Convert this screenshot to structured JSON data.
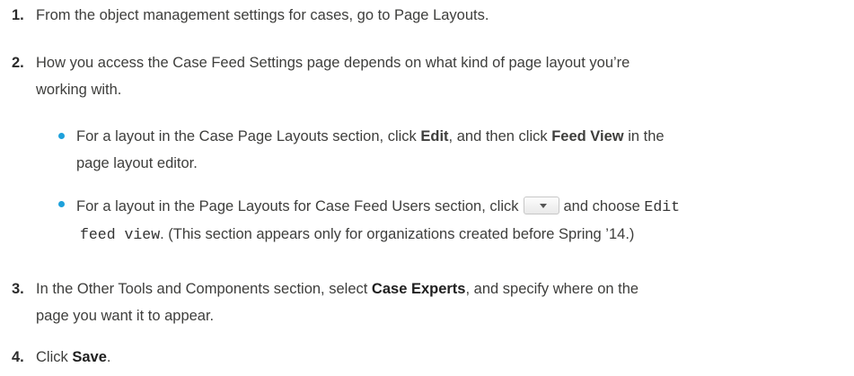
{
  "steps": [
    {
      "number": "1.",
      "text": "From the object management settings for cases, go to Page Layouts."
    },
    {
      "number": "2.",
      "text_line1": "How you access the Case Feed Settings page depends on what kind of page layout you’re",
      "text_line2": "working with.",
      "bullets": [
        {
          "pre": "For a layout in the Case Page Layouts section, click ",
          "bold1": "Edit",
          "mid": ", and then click ",
          "bold2": "Feed View",
          "post": " in the",
          "line2": "page layout editor."
        },
        {
          "pre": "For a layout in the Page Layouts for Case Feed Users section, click",
          "dropdown_icon": "dropdown-menu-button-icon",
          "mid": "and choose",
          "code1": "Edit",
          "code2": "feed view",
          "post": ". (This section appears only for organizations created before Spring ’14.)"
        }
      ]
    },
    {
      "number": "3.",
      "pre": "In the Other Tools and Components section, select ",
      "bold": "Case Experts",
      "post": ", and specify where on the",
      "line2": "page you want it to appear."
    },
    {
      "number": "4.",
      "pre": "Click ",
      "bold": "Save",
      "post": "."
    }
  ],
  "colors": {
    "bullet": "#1ea1db",
    "text": "#3e3e3c"
  }
}
